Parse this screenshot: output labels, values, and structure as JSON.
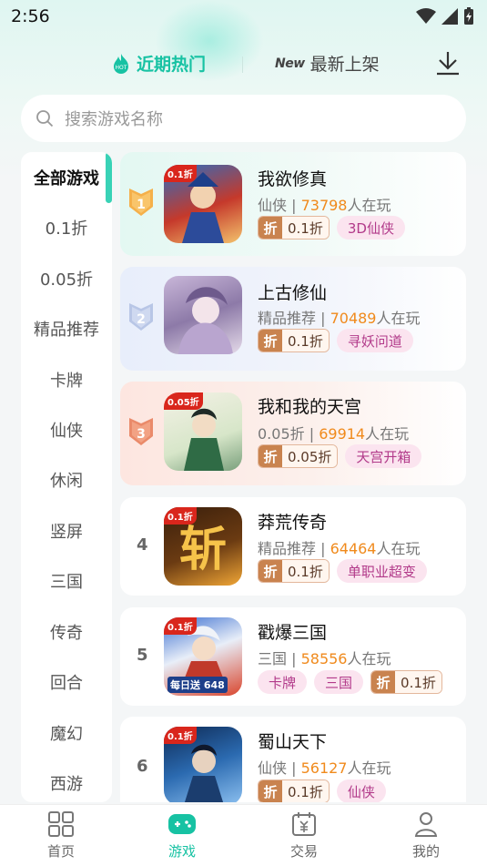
{
  "status": {
    "time": "2:56"
  },
  "tabs": {
    "hot": "近期热门",
    "new_badge": "New",
    "new": "最新上架"
  },
  "search": {
    "placeholder": "搜索游戏名称"
  },
  "sidebar": {
    "items": [
      "全部游戏",
      "0.1折",
      "0.05折",
      "精品推荐",
      "卡牌",
      "仙侠",
      "休闲",
      "竖屏",
      "三国",
      "传奇",
      "回合",
      "魔幻",
      "西游"
    ],
    "active": "全部游戏"
  },
  "games": [
    {
      "rank": "1",
      "icon_tag": "0.1折",
      "name": "我欲修真",
      "category": "仙侠",
      "players": "73798",
      "players_suffix": "人在玩",
      "discount_label": "折",
      "discount": "0.1折",
      "tags": [
        "3D仙侠"
      ]
    },
    {
      "rank": "2",
      "name": "上古修仙",
      "category": "精品推荐",
      "players": "70489",
      "players_suffix": "人在玩",
      "discount_label": "折",
      "discount": "0.1折",
      "tags": [
        "寻妖问道"
      ]
    },
    {
      "rank": "3",
      "icon_tag": "0.05折",
      "name": "我和我的天宫",
      "category": "0.05折",
      "players": "69914",
      "players_suffix": "人在玩",
      "discount_label": "折",
      "discount": "0.05折",
      "tags": [
        "天宫开箱"
      ]
    },
    {
      "rank": "4",
      "icon_tag": "0.1折",
      "name": "莽荒传奇",
      "category": "精品推荐",
      "players": "64464",
      "players_suffix": "人在玩",
      "discount_label": "折",
      "discount": "0.1折",
      "tags": [
        "单职业超变"
      ]
    },
    {
      "rank": "5",
      "icon_tag": "0.1折",
      "icon_caption": "每日送 648",
      "name": "戳爆三国",
      "category": "三国",
      "players": "58556",
      "players_suffix": "人在玩",
      "discount_label": "折",
      "discount": "0.1折",
      "tags": [
        "卡牌",
        "三国"
      ]
    },
    {
      "rank": "6",
      "icon_tag": "0.1折",
      "name": "蜀山天下",
      "category": "仙侠",
      "players": "56127",
      "players_suffix": "人在玩",
      "discount_label": "折",
      "discount": "0.1折",
      "tags": [
        "仙侠"
      ]
    }
  ],
  "bottom_nav": [
    "首页",
    "游戏",
    "交易",
    "我的"
  ],
  "colors": {
    "accent": "#17c2a3",
    "players": "#f08a1c",
    "pill_bg": "#fbe4ef",
    "pill_text": "#b23a8a"
  }
}
